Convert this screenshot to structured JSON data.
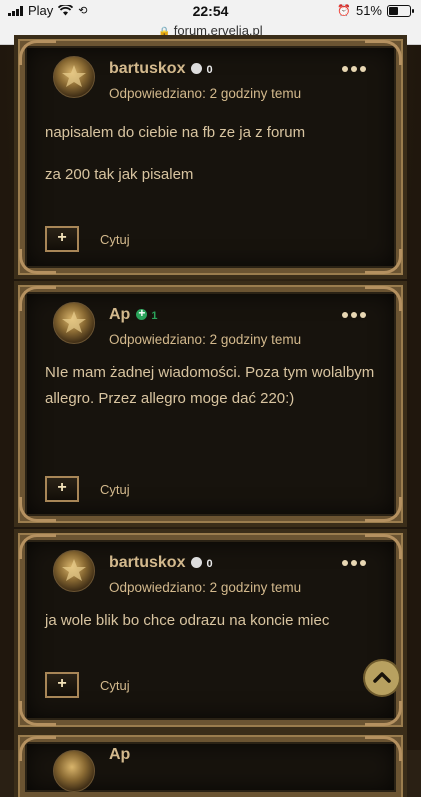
{
  "status_bar": {
    "carrier": "Play",
    "time": "22:54",
    "battery": "51%",
    "battery_level": 0.51
  },
  "url_bar": {
    "url": "forum.ervelia.pl"
  },
  "posts": [
    {
      "username": "bartuskox",
      "reputation": "0",
      "meta": "Odpowiedziano: 2 godziny temu",
      "content": [
        "napisalem do ciebie na fb ze ja z forum",
        "za 200 tak jak pisalem"
      ],
      "quote_label": "Cytuj",
      "quote_symbol": "+"
    },
    {
      "username": "Ap",
      "reputation": "1",
      "meta": "Odpowiedziano: 2 godziny temu",
      "content": [
        "NIe mam żadnej wiadomości. Poza tym wolalbym allegro. Przez allegro moge dać 220:)"
      ],
      "quote_label": "Cytuj",
      "quote_symbol": "+"
    },
    {
      "username": "bartuskox",
      "reputation": "0",
      "meta": "Odpowiedziano: 2 godziny temu",
      "content": [
        "ja wole blik bo chce odrazu na koncie miec"
      ],
      "quote_label": "Cytuj",
      "quote_symbol": "+"
    }
  ],
  "peek_username": "Ap",
  "icons": {
    "more": "more-dots-icon",
    "scroll_top": "chevron-up-icon",
    "lock": "lock-icon",
    "wifi": "wifi-icon",
    "alarm": "alarm-icon"
  },
  "colors": {
    "gold_text": "#d3b98d",
    "online": "#2aa35a",
    "frame": "#6b5432"
  }
}
